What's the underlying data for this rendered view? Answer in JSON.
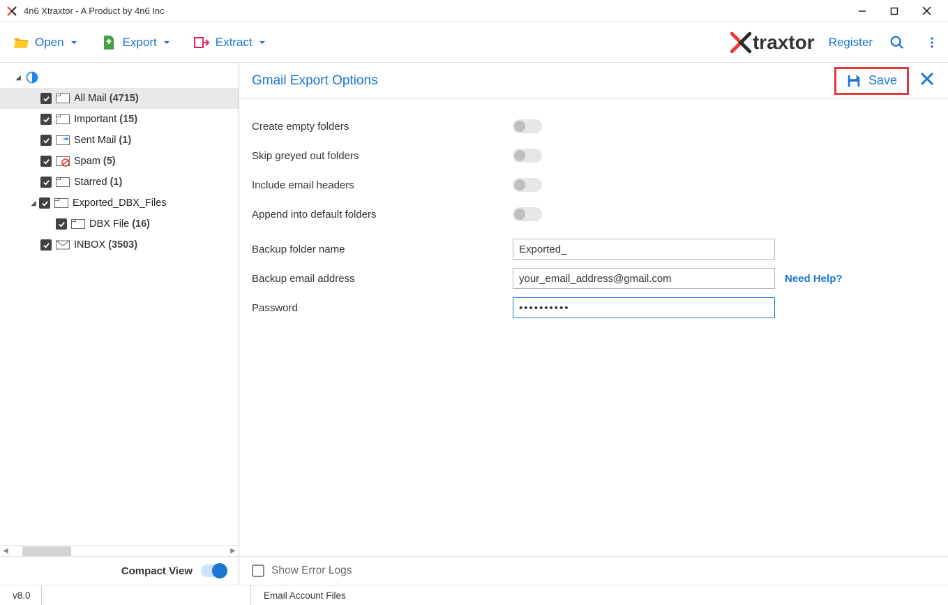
{
  "window": {
    "title": "4n6 Xtraxtor - A Product by 4n6 Inc"
  },
  "toolbar": {
    "open": "Open",
    "export": "Export",
    "extract": "Extract",
    "logo_text": "traxtor",
    "register": "Register"
  },
  "tree": {
    "items": [
      {
        "label": "All Mail",
        "count": "(4715)",
        "selected": true,
        "icon": "folder"
      },
      {
        "label": "Important",
        "count": "(15)",
        "icon": "folder"
      },
      {
        "label": "Sent Mail",
        "count": "(1)",
        "icon": "sent"
      },
      {
        "label": "Spam",
        "count": "(5)",
        "icon": "spam"
      },
      {
        "label": "Starred",
        "count": "(1)",
        "icon": "folder"
      },
      {
        "label": "Exported_DBX_Files",
        "count": "",
        "icon": "folder",
        "hasChildren": true
      },
      {
        "label": "DBX File",
        "count": "(16)",
        "icon": "folder",
        "level": 2
      },
      {
        "label": "INBOX",
        "count": "(3503)",
        "icon": "inbox"
      }
    ]
  },
  "sidebar": {
    "compact_view": "Compact View"
  },
  "main": {
    "title": "Gmail Export Options",
    "save": "Save",
    "options": {
      "create_empty": "Create empty folders",
      "skip_greyed": "Skip greyed out folders",
      "include_headers": "Include email headers",
      "append_default": "Append into default folders",
      "backup_folder": "Backup folder name",
      "backup_folder_value": "Exported_",
      "backup_email": "Backup email address",
      "backup_email_value": "your_email_address@gmail.com",
      "password": "Password",
      "password_value": "••••••••••",
      "need_help": "Need Help?"
    },
    "show_error_logs": "Show Error Logs"
  },
  "statusbar": {
    "version": "v8.0",
    "status": "Email Account Files"
  }
}
